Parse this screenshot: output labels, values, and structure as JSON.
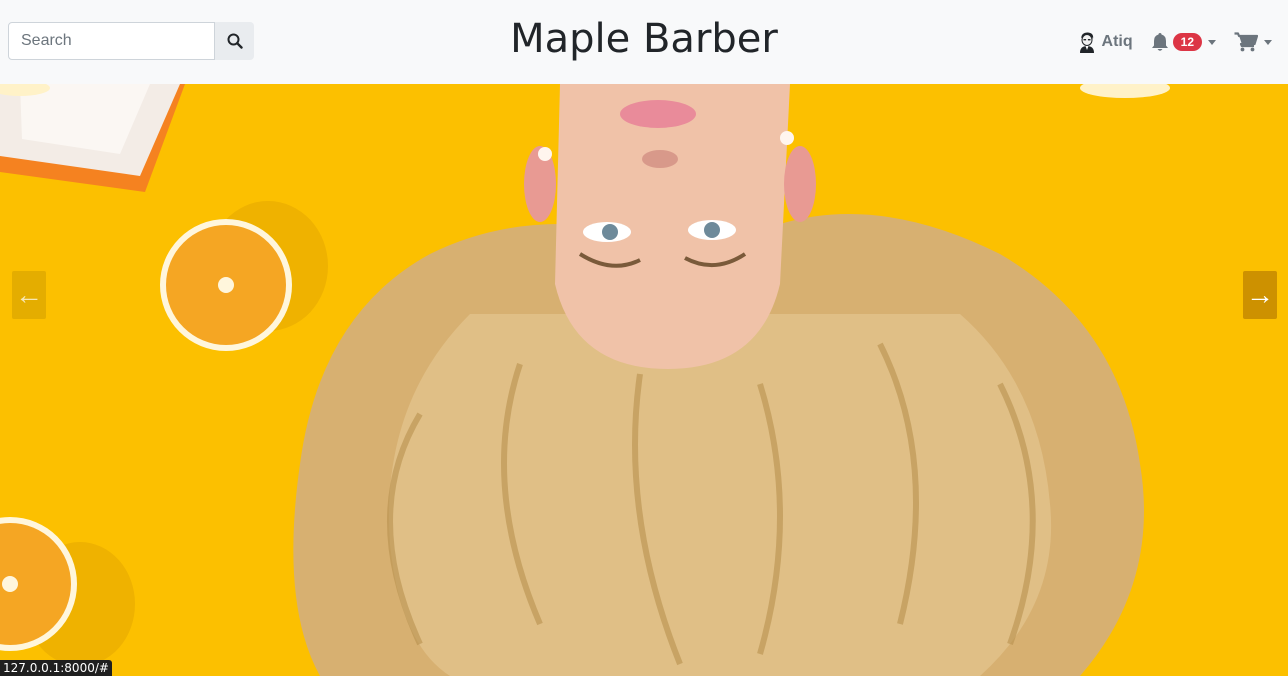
{
  "navbar": {
    "search": {
      "placeholder": "Search",
      "value": ""
    },
    "brand": "Maple Barber",
    "user": {
      "name": "Atiq"
    },
    "notifications": {
      "count": "12"
    }
  },
  "carousel": {
    "prev_label": "←",
    "next_label": "→"
  },
  "status_bar": {
    "url": "127.0.0.1:8000/#"
  },
  "colors": {
    "navbar_bg": "#f8f9fa",
    "hero_bg": "#fcc000",
    "badge": "#dc3545",
    "text_dark": "#212529",
    "text_muted": "#6c757d"
  }
}
